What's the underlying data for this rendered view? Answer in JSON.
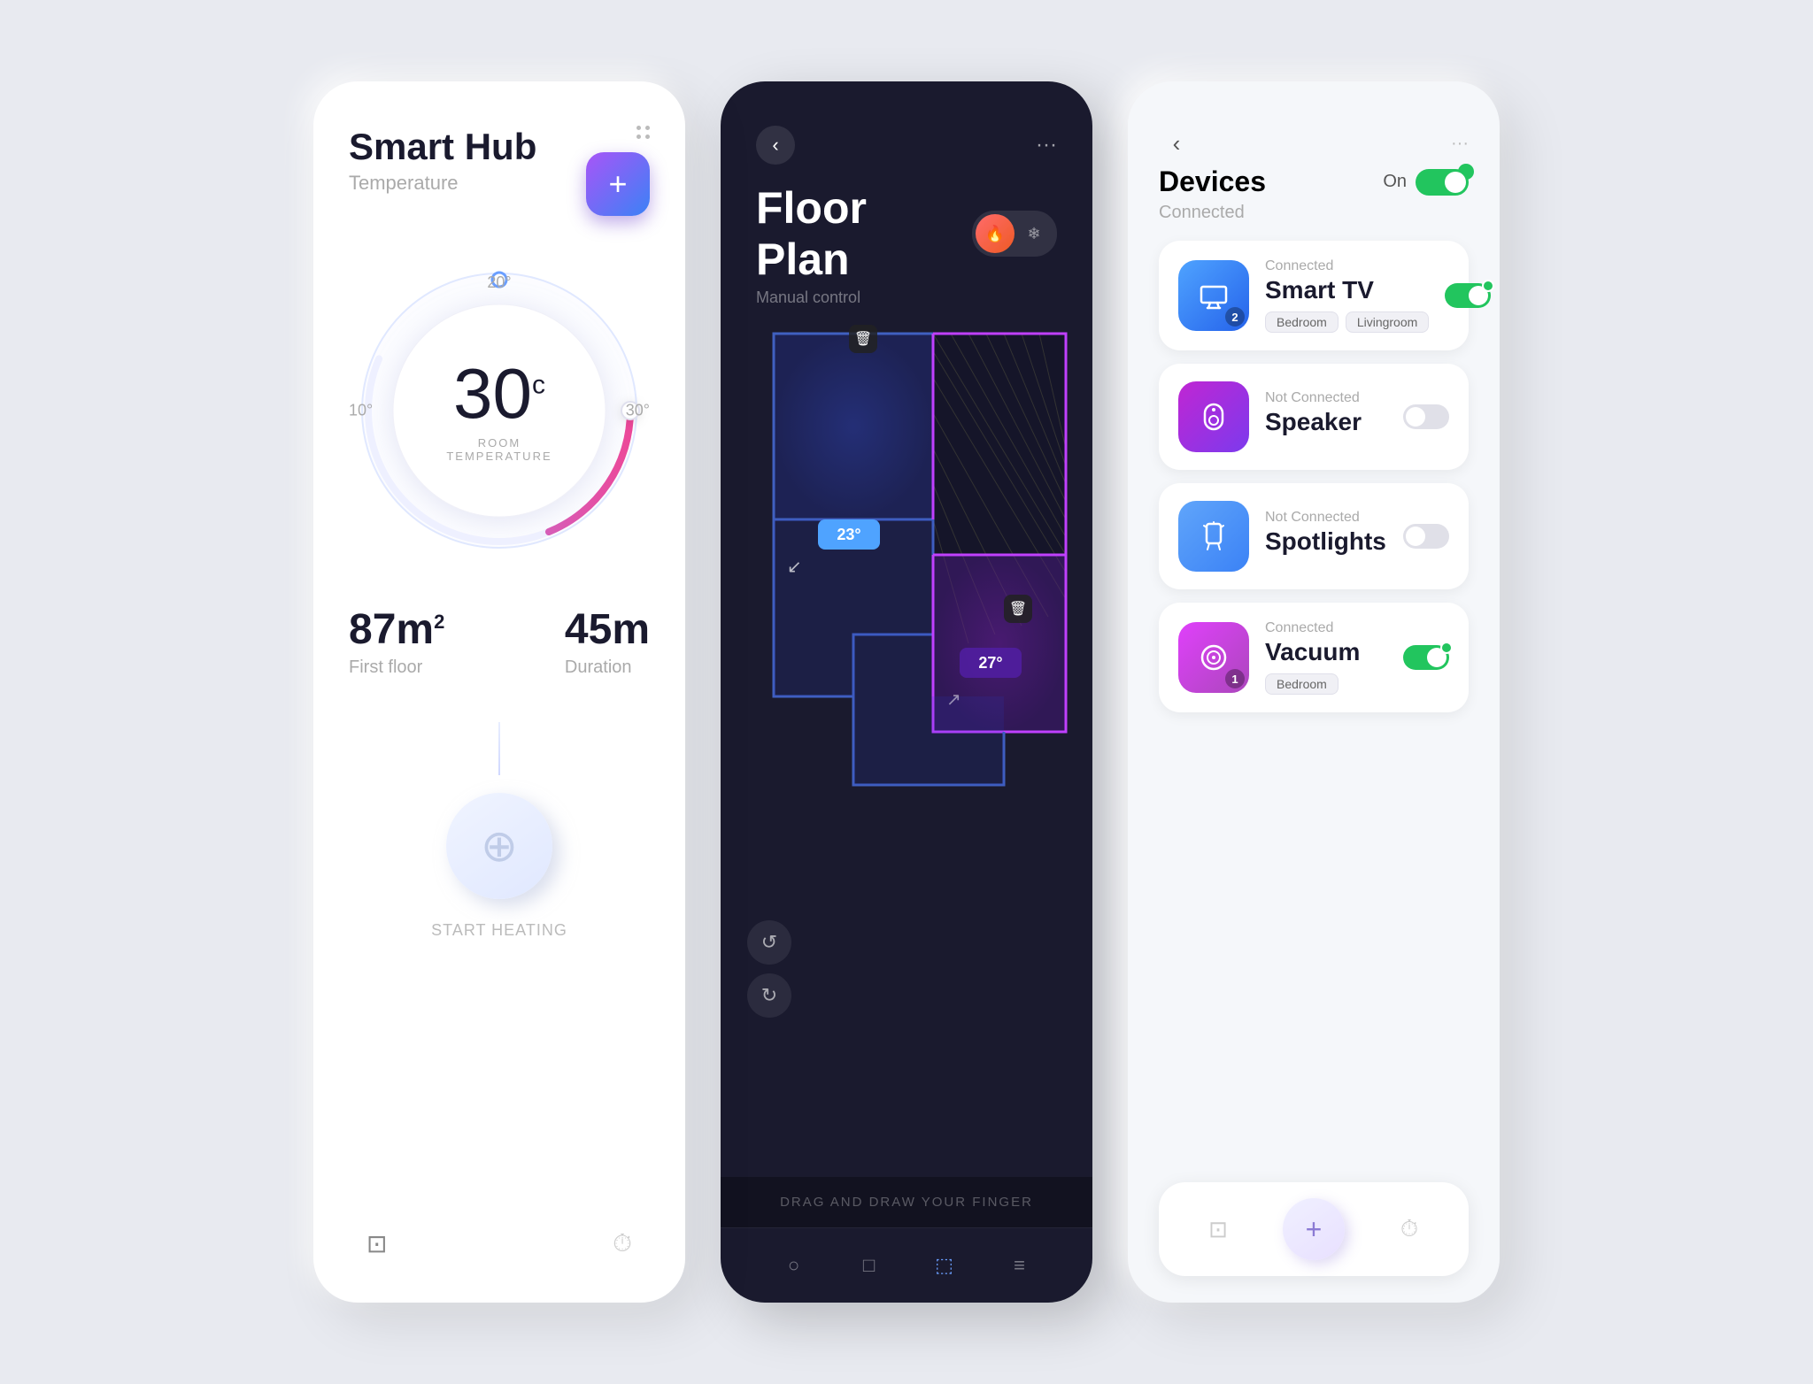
{
  "panel1": {
    "title": "Smart Hub",
    "subtitle": "Temperature",
    "add_label": "+",
    "temp_value": "30",
    "temp_unit": "c",
    "temp_label": "ROOM\nTEMPERATURE",
    "scale_20": "20°",
    "scale_10": "10°",
    "scale_30": "30°",
    "stat1_value": "87m",
    "stat1_sup": "2",
    "stat1_label": "First floor",
    "stat2_value": "45m",
    "stat2_label": "Duration",
    "start_heating": "START HEATING"
  },
  "panel2": {
    "title": "Floor Plan",
    "subtitle": "Manual control",
    "drag_hint": "DRAG AND DRAW YOUR FINGER",
    "temp1": "23°",
    "temp2": "27°"
  },
  "panel3": {
    "title": "Devices",
    "on_label": "On",
    "connected_label": "Connected",
    "devices": [
      {
        "name": "Smart TV",
        "status": "Connected",
        "tags": [
          "Bedroom",
          "Livingroom"
        ],
        "connected": true,
        "icon": "tv",
        "badge": "2",
        "color": "blue"
      },
      {
        "name": "Speaker",
        "status": "Not Connected",
        "tags": [],
        "connected": false,
        "icon": "speaker",
        "badge": null,
        "color": "purple"
      },
      {
        "name": "Spotlights",
        "status": "Not Connected",
        "tags": [],
        "connected": false,
        "icon": "light",
        "badge": null,
        "color": "blue-light"
      },
      {
        "name": "Vacuum",
        "status": "Connected",
        "tags": [
          "Bedroom"
        ],
        "connected": true,
        "icon": "vacuum",
        "badge": "1",
        "color": "magenta"
      }
    ]
  }
}
